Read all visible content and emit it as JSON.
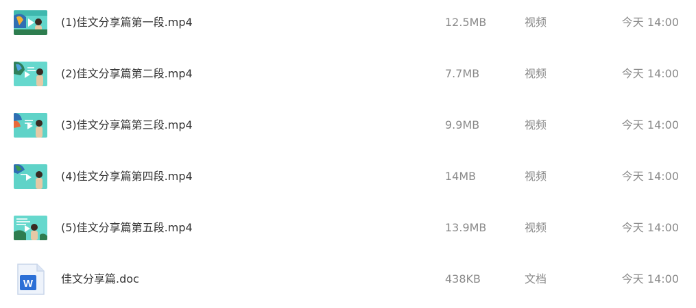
{
  "files": [
    {
      "name": "(1)佳文分享篇第一段.mp4",
      "size": "12.5MB",
      "type": "视频",
      "modified": "今天 14:00",
      "icon": "video-thumbnail-icon"
    },
    {
      "name": "(2)佳文分享篇第二段.mp4",
      "size": "7.7MB",
      "type": "视频",
      "modified": "今天 14:00",
      "icon": "video-thumbnail-icon"
    },
    {
      "name": "(3)佳文分享篇第三段.mp4",
      "size": "9.9MB",
      "type": "视频",
      "modified": "今天 14:00",
      "icon": "video-thumbnail-icon"
    },
    {
      "name": "(4)佳文分享篇第四段.mp4",
      "size": "14MB",
      "type": "视频",
      "modified": "今天 14:00",
      "icon": "video-thumbnail-icon"
    },
    {
      "name": "(5)佳文分享篇第五段.mp4",
      "size": "13.9MB",
      "type": "视频",
      "modified": "今天 14:00",
      "icon": "video-thumbnail-icon"
    },
    {
      "name": "佳文分享篇.doc",
      "size": "438KB",
      "type": "文档",
      "modified": "今天 14:00",
      "icon": "word-doc-icon"
    }
  ],
  "colors": {
    "text_primary": "#333333",
    "text_secondary": "#8a8a8a",
    "thumb_teal": "#5fd3c8",
    "word_blue": "#2b6fd6"
  }
}
